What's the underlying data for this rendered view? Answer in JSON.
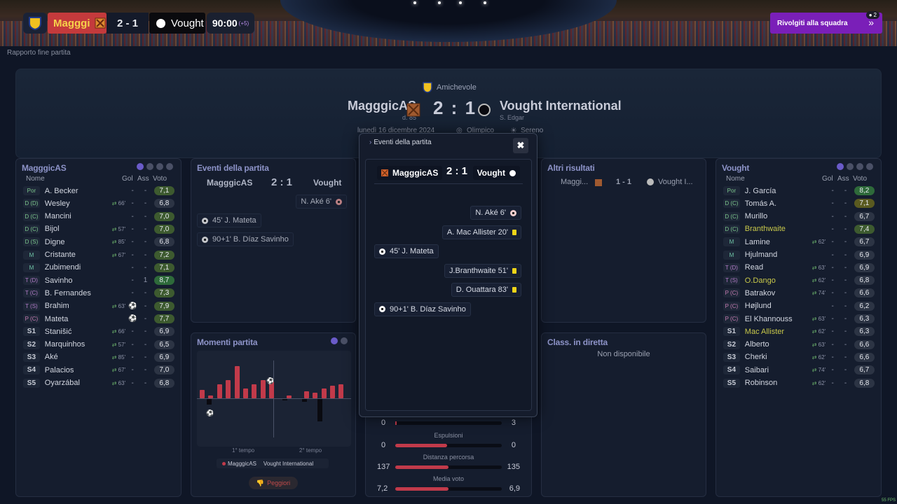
{
  "topbar": {
    "home_abbr": "Magggi",
    "score": "2 - 1",
    "away_abbr": "Vought",
    "time": "90:00",
    "added": "(+5)",
    "talk_button": "Rivolgiti alla squadra",
    "notif_count": "2"
  },
  "breadcrumb": "Rapporto fine partita",
  "header": {
    "competition": "Amichevole",
    "home_team": "MagggicAS",
    "home_sub": "d. 85",
    "score": "2 : 1",
    "away_team": "Vought International",
    "away_sub": "S. Edgar",
    "date": "lunedì 16 dicembre 2024",
    "stadium": "Olimpico",
    "weather": "Sereno"
  },
  "home_panel": {
    "title": "MagggicAS",
    "col_name": "Nome",
    "col_gol": "Gol",
    "col_ass": "Ass",
    "col_voto": "Voto",
    "players": [
      {
        "pos": "Por",
        "name": "A. Becker",
        "sub": "",
        "gol": "-",
        "ass": "-",
        "voto": "7,1",
        "color": "#3d5a2f"
      },
      {
        "pos": "D (D)",
        "name": "Wesley",
        "sub": "66'",
        "gol": "-",
        "ass": "-",
        "voto": "6,8",
        "color": "#2c3444"
      },
      {
        "pos": "D (C)",
        "name": "Mancini",
        "sub": "",
        "gol": "-",
        "ass": "-",
        "voto": "7,0",
        "color": "#3d5a2f"
      },
      {
        "pos": "D (C)",
        "name": "Bijol",
        "sub": "57'",
        "gol": "-",
        "ass": "-",
        "voto": "7,0",
        "color": "#3d5a2f"
      },
      {
        "pos": "D (S)",
        "name": "Digne",
        "sub": "85'",
        "gol": "-",
        "ass": "-",
        "voto": "6,8",
        "color": "#2c3444"
      },
      {
        "pos": "M",
        "name": "Cristante",
        "sub": "67'",
        "gol": "-",
        "ass": "-",
        "voto": "7,2",
        "color": "#3d5a2f"
      },
      {
        "pos": "M",
        "name": "Zubimendi",
        "sub": "",
        "gol": "-",
        "ass": "-",
        "voto": "7,1",
        "color": "#3d5a2f"
      },
      {
        "pos": "T (D)",
        "name": "Savinho",
        "sub": "",
        "gol": "-",
        "ass": "1",
        "voto": "8,7",
        "color": "#2e6a3a"
      },
      {
        "pos": "T (C)",
        "name": "B. Fernandes",
        "sub": "",
        "gol": "-",
        "ass": "-",
        "voto": "7,3",
        "color": "#3d5a2f"
      },
      {
        "pos": "T (S)",
        "name": "Brahim",
        "sub": "63'",
        "gol": "⚽",
        "ass": "-",
        "voto": "7,9",
        "color": "#3d5a2f"
      },
      {
        "pos": "P (C)",
        "name": "Mateta",
        "sub": "",
        "gol": "⚽",
        "ass": "-",
        "voto": "7,7",
        "color": "#3d5a2f"
      },
      {
        "pos": "S1",
        "name": "Stanišić",
        "sub": "66'",
        "gol": "-",
        "ass": "-",
        "voto": "6,9",
        "color": "#2c3444"
      },
      {
        "pos": "S2",
        "name": "Marquinhos",
        "sub": "57'",
        "gol": "-",
        "ass": "-",
        "voto": "6,5",
        "color": "#2c3444"
      },
      {
        "pos": "S3",
        "name": "Aké",
        "sub": "85'",
        "gol": "-",
        "ass": "-",
        "voto": "6,9",
        "color": "#2c3444"
      },
      {
        "pos": "S4",
        "name": "Palacios",
        "sub": "67'",
        "gol": "-",
        "ass": "-",
        "voto": "7,0",
        "color": "#2c3444"
      },
      {
        "pos": "S5",
        "name": "Oyarzábal",
        "sub": "63'",
        "gol": "-",
        "ass": "-",
        "voto": "6,8",
        "color": "#2c3444"
      }
    ]
  },
  "away_panel": {
    "title": "Vought",
    "col_name": "Nome",
    "col_gol": "Gol",
    "col_ass": "Ass",
    "col_voto": "Voto",
    "players": [
      {
        "pos": "Por",
        "name": "J. García",
        "sub": "",
        "gol": "-",
        "ass": "-",
        "voto": "8,2",
        "color": "#2e6a3a"
      },
      {
        "pos": "D (C)",
        "name": "Tomás A.",
        "sub": "",
        "gol": "-",
        "ass": "-",
        "voto": "7,1",
        "color": "#5a5a20"
      },
      {
        "pos": "D (C)",
        "name": "Murillo",
        "sub": "",
        "gol": "-",
        "ass": "-",
        "voto": "6,7",
        "color": "#2c3444"
      },
      {
        "pos": "D (C)",
        "name": "Branthwaite",
        "sub": "",
        "gol": "-",
        "ass": "-",
        "voto": "7,4",
        "color": "#3d5a2f"
      },
      {
        "pos": "M",
        "name": "Lamine",
        "sub": "62'",
        "gol": "-",
        "ass": "-",
        "voto": "6,7",
        "color": "#2c3444"
      },
      {
        "pos": "M",
        "name": "Hjulmand",
        "sub": "",
        "gol": "-",
        "ass": "-",
        "voto": "6,9",
        "color": "#2c3444"
      },
      {
        "pos": "T (D)",
        "name": "Read",
        "sub": "63'",
        "gol": "-",
        "ass": "-",
        "voto": "6,9",
        "color": "#2c3444"
      },
      {
        "pos": "T (S)",
        "name": "O.Dango",
        "sub": "62'",
        "gol": "-",
        "ass": "-",
        "voto": "6,8",
        "color": "#2c3444"
      },
      {
        "pos": "P (C)",
        "name": "Batrakov",
        "sub": "74'",
        "gol": "-",
        "ass": "-",
        "voto": "6,6",
        "color": "#2c3444"
      },
      {
        "pos": "P (C)",
        "name": "Højlund",
        "sub": "",
        "gol": "-",
        "ass": "-",
        "voto": "6,2",
        "color": "#2c3444"
      },
      {
        "pos": "P (C)",
        "name": "El Khannouss",
        "sub": "63'",
        "gol": "-",
        "ass": "-",
        "voto": "6,3",
        "color": "#2c3444"
      },
      {
        "pos": "S1",
        "name": "Mac Allister",
        "sub": "62'",
        "gol": "-",
        "ass": "-",
        "voto": "6,3",
        "color": "#2c3444"
      },
      {
        "pos": "S2",
        "name": "Alberto",
        "sub": "63'",
        "gol": "-",
        "ass": "-",
        "voto": "6,6",
        "color": "#2c3444"
      },
      {
        "pos": "S3",
        "name": "Cherki",
        "sub": "62'",
        "gol": "-",
        "ass": "-",
        "voto": "6,6",
        "color": "#2c3444"
      },
      {
        "pos": "S4",
        "name": "Saibari",
        "sub": "74'",
        "gol": "-",
        "ass": "-",
        "voto": "6,7",
        "color": "#2c3444"
      },
      {
        "pos": "S5",
        "name": "Robinson",
        "sub": "62'",
        "gol": "-",
        "ass": "-",
        "voto": "6,8",
        "color": "#2c3444"
      }
    ]
  },
  "events_panel": {
    "title": "Eventi della partita",
    "home": "MagggicAS",
    "score": "2 : 1",
    "away": "Vought",
    "ev_away_1": "N. Aké 6'",
    "ev_home_1": "45' J. Mateta",
    "ev_home_2": "90+1' B. Díaz Savinho"
  },
  "moments_panel": {
    "title": "Momenti partita",
    "half1": "1° tempo",
    "half2": "2° tempo",
    "legend_home": "MagggicAS",
    "legend_away": "Vought International",
    "worst_button": "Peggiori"
  },
  "others_panel": {
    "title": "Altri risultati",
    "home": "Maggi...",
    "score": "1 - 1",
    "away": "Vought I..."
  },
  "live_panel": {
    "title": "Class. in diretta",
    "empty": "Non disponibile"
  },
  "stats": {
    "row1_home": "0",
    "row1_away": "3",
    "label2": "Espulsioni",
    "row2_home": "0",
    "row2_away": "0",
    "label3": "Distanza percorsa",
    "row3_home": "137",
    "row3_away": "135",
    "label4": "Media voto",
    "row4_home": "7,2",
    "row4_away": "6,9"
  },
  "modal": {
    "title": "Eventi della partita",
    "home": "MagggicAS",
    "score": "2 : 1",
    "away": "Vought",
    "events": [
      {
        "side": "away",
        "text": "N. Aké 6'",
        "type": "goal"
      },
      {
        "side": "away",
        "text": "A. Mac Allister 20'",
        "type": "yellow"
      },
      {
        "side": "home",
        "text": "45' J. Mateta",
        "type": "goal"
      },
      {
        "side": "away",
        "text": "J.Branthwaite 51'",
        "type": "yellow"
      },
      {
        "side": "away",
        "text": "D. Ouattara 83'",
        "type": "yellow"
      },
      {
        "side": "home",
        "text": "90+1' B. Díaz Savinho",
        "type": "goal"
      }
    ]
  },
  "fps": "55 FPS"
}
